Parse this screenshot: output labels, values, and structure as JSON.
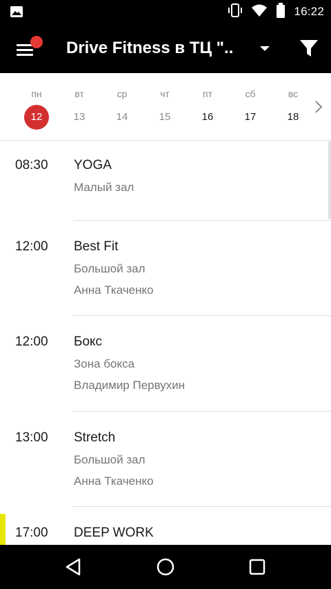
{
  "status_bar": {
    "time": "16:22",
    "icons": [
      "image-icon",
      "vibrate-icon",
      "wifi-icon",
      "battery-icon"
    ]
  },
  "app_bar": {
    "title": "Drive Fitness в ТЦ \"..",
    "menu_icon": "hamburger-menu-icon",
    "notification_color": "#e53935",
    "dropdown_icon": "caret-down-icon",
    "filter_icon": "filter-icon"
  },
  "week": {
    "days": [
      {
        "name": "пн",
        "number": "12",
        "selected": true
      },
      {
        "name": "вт",
        "number": "13",
        "selected": false
      },
      {
        "name": "ср",
        "number": "14",
        "selected": false
      },
      {
        "name": "чт",
        "number": "15",
        "selected": false
      },
      {
        "name": "пт",
        "number": "16",
        "selected": false
      },
      {
        "name": "сб",
        "number": "17",
        "selected": false
      },
      {
        "name": "вс",
        "number": "18",
        "selected": false
      }
    ],
    "selected_color": "#d32f2f",
    "next_icon": "chevron-right-icon"
  },
  "schedule": [
    {
      "time": "08:30",
      "title": "YOGA",
      "room": "Малый зал",
      "trainer": ""
    },
    {
      "time": "12:00",
      "title": "Best Fit",
      "room": "Большой зал",
      "trainer": "Анна Ткаченко"
    },
    {
      "time": "12:00",
      "title": "Бокс",
      "room": "Зона бокса",
      "trainer": "Владимир Первухин"
    },
    {
      "time": "13:00",
      "title": "Stretch",
      "room": "Большой зал",
      "trainer": "Анна Ткаченко"
    },
    {
      "time": "17:00",
      "title": "DEEP WORK",
      "room": "",
      "trainer": "",
      "marker_color": "#e6e600"
    }
  ],
  "nav_bar": {
    "icons": [
      "back-icon",
      "home-icon",
      "recents-icon"
    ]
  }
}
